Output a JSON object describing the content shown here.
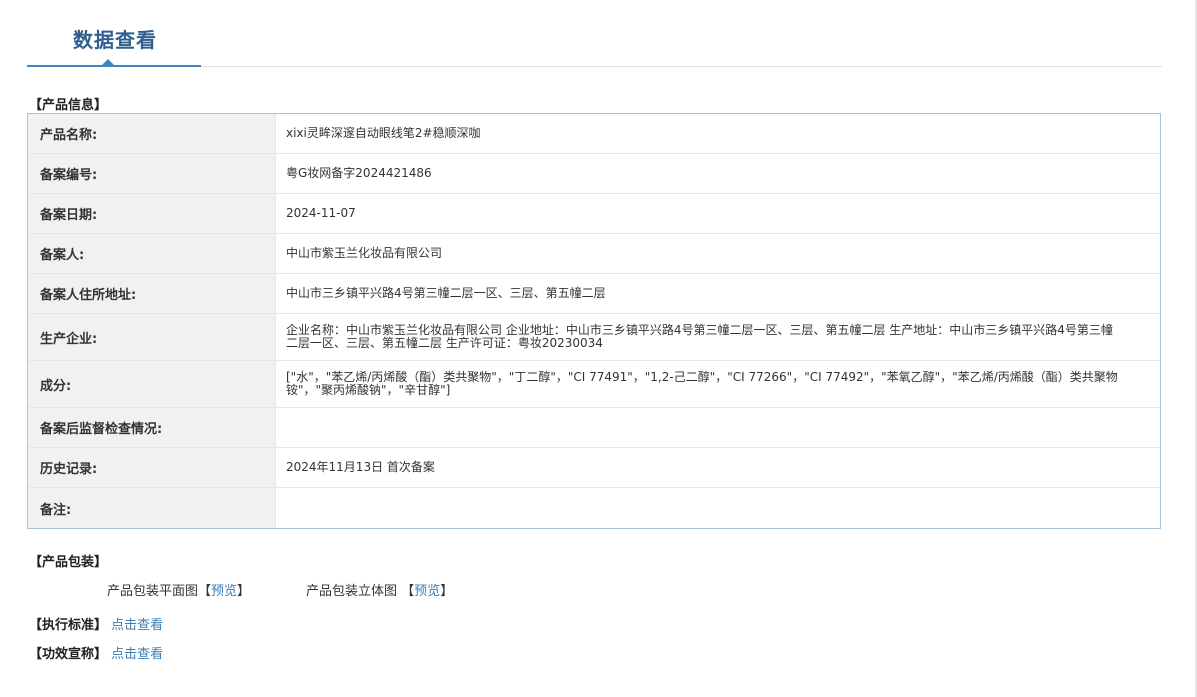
{
  "header": {
    "title": "数据查看"
  },
  "product_info": {
    "section_title": "【产品信息】",
    "rows": [
      {
        "label": "产品名称:",
        "value": "xixi灵眸深邃自动眼线笔2#稳顺深咖"
      },
      {
        "label": "备案编号:",
        "value": "粤G妆网备字2024421486"
      },
      {
        "label": "备案日期:",
        "value": "2024-11-07"
      },
      {
        "label": "备案人:",
        "value": "中山市紫玉兰化妆品有限公司"
      },
      {
        "label": "备案人住所地址:",
        "value": "中山市三乡镇平兴路4号第三幢二层一区、三层、第五幢二层"
      },
      {
        "label": "生产企业:",
        "value": "企业名称：中山市紫玉兰化妆品有限公司 企业地址：中山市三乡镇平兴路4号第三幢二层一区、三层、第五幢二层 生产地址：中山市三乡镇平兴路4号第三幢二层一区、三层、第五幢二层 生产许可证：粤妆20230034"
      },
      {
        "label": "成分:",
        "value": "[\"水\"，\"苯乙烯/丙烯酸（酯）类共聚物\"，\"丁二醇\"，\"CI 77491\"，\"1,2-己二醇\"，\"CI 77266\"，\"CI 77492\"，\"苯氧乙醇\"，\"苯乙烯/丙烯酸（酯）类共聚物铵\"，\"聚丙烯酸钠\"，\"辛甘醇\"]"
      },
      {
        "label": "备案后监督检查情况:",
        "value": ""
      },
      {
        "label": "历史记录:",
        "value": "2024年11月13日 首次备案"
      },
      {
        "label": "备注:",
        "value": ""
      }
    ]
  },
  "packaging": {
    "section_title": "【产品包装】",
    "flat": {
      "label": "产品包装平面图",
      "bracket_open": "【",
      "link": "预览",
      "bracket_close": "】"
    },
    "solid": {
      "label": "产品包装立体图",
      "bracket_open": "【",
      "link": "预览",
      "bracket_close": "】"
    }
  },
  "standard": {
    "label": "【执行标准】",
    "link": "点击查看"
  },
  "efficacy": {
    "label": "【功效宣称】",
    "link": "点击查看"
  }
}
